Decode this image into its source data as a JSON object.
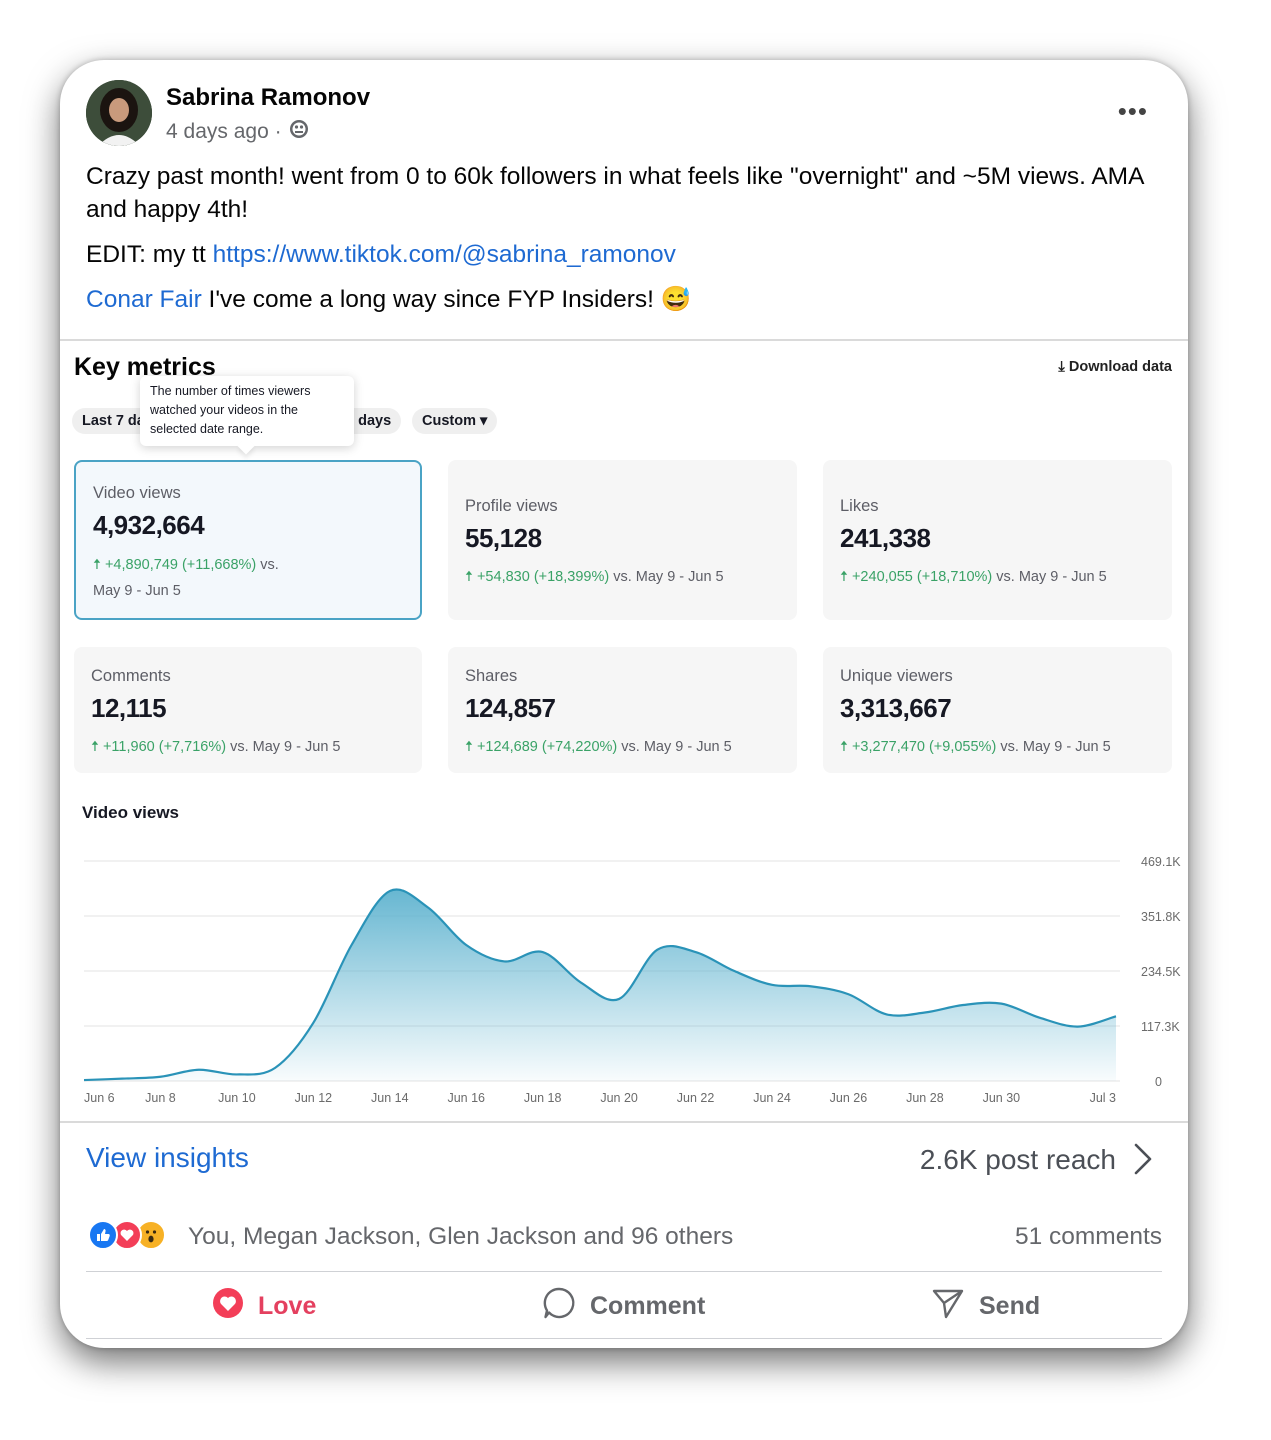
{
  "post": {
    "author": "Sabrina Ramonov",
    "time": "4 days ago ·",
    "audience_icon": "globe-icon",
    "line1": "Crazy past month! went from 0 to 60k followers in what feels like \"overnight\" and ~5M views. AMA and happy 4th!",
    "edit_prefix": "EDIT: my tt ",
    "edit_link": "https://www.tiktok.com/@sabrina_ramonov",
    "mention": "Conar Fair",
    "mention_text": " I've come a long way since FYP Insiders! 😅"
  },
  "analytics": {
    "title": "Key metrics",
    "download": "Download data",
    "chips": [
      "Last 7 da",
      "0 days",
      "Custom ▾"
    ],
    "tooltip": "The number of times viewers watched your videos in the selected date range.",
    "metrics": [
      {
        "label": "Video views",
        "value": "4,932,664",
        "delta": "+4,890,749 (+11,668%)",
        "vs": "vs.",
        "period": "May 9 - Jun 5"
      },
      {
        "label": "Profile views",
        "value": "55,128",
        "delta": "+54,830 (+18,399%)",
        "vs": "vs.",
        "period": "May 9 - Jun 5"
      },
      {
        "label": "Likes",
        "value": "241,338",
        "delta": "+240,055 (+18,710%)",
        "vs": "vs.",
        "period": "May 9 - Jun 5"
      },
      {
        "label": "Comments",
        "value": "12,115",
        "delta": "+11,960 (+7,716%)",
        "vs": "vs.",
        "period": "May 9 - Jun 5"
      },
      {
        "label": "Shares",
        "value": "124,857",
        "delta": "+124,689 (+74,220%)",
        "vs": "vs.",
        "period": "May 9 - Jun 5"
      },
      {
        "label": "Unique viewers",
        "value": "3,313,667",
        "delta": "+3,277,470 (+9,055%)",
        "vs": "vs.",
        "period": "May 9 - Jun 5"
      }
    ],
    "accent": "#4aa3c5",
    "positive_color": "#3aa267"
  },
  "chart_data": {
    "type": "area",
    "title": "Video views",
    "x": [
      "Jun 6",
      "Jun 7",
      "Jun 8",
      "Jun 9",
      "Jun 10",
      "Jun 11",
      "Jun 12",
      "Jun 13",
      "Jun 14",
      "Jun 15",
      "Jun 16",
      "Jun 17",
      "Jun 18",
      "Jun 19",
      "Jun 20",
      "Jun 21",
      "Jun 22",
      "Jun 23",
      "Jun 24",
      "Jun 25",
      "Jun 26",
      "Jun 27",
      "Jun 28",
      "Jun 29",
      "Jun 30",
      "Jul 1",
      "Jul 2",
      "Jul 3"
    ],
    "values": [
      2000,
      5000,
      9000,
      24000,
      14000,
      28000,
      124000,
      290000,
      405000,
      370000,
      290000,
      255000,
      275000,
      210000,
      175000,
      280000,
      275000,
      235000,
      205000,
      202000,
      185000,
      142000,
      146000,
      162000,
      165000,
      135000,
      116000,
      138000
    ],
    "x_tick_labels": [
      "Jun 6",
      "Jun 8",
      "Jun 10",
      "Jun 12",
      "Jun 14",
      "Jun 16",
      "Jun 18",
      "Jun 20",
      "Jun 22",
      "Jun 24",
      "Jun 26",
      "Jun 28",
      "Jun 30",
      "Jul 3"
    ],
    "y_tick_labels": [
      "469.1K",
      "351.8K",
      "234.5K",
      "117.3K",
      "0"
    ],
    "y_ticks": [
      469100,
      351800,
      234500,
      117300,
      0
    ],
    "ylim": [
      0,
      469100
    ],
    "grid": true,
    "line_color": "#2a93b8",
    "fill_color": "#5fb3cf"
  },
  "footer": {
    "insights": "View insights",
    "reach": "2.6K post reach",
    "reactions_text": "You, Megan Jackson, Glen Jackson and 96 others",
    "comments": "51 comments",
    "love": "Love",
    "comment": "Comment",
    "send": "Send",
    "love_color": "#e4405f",
    "link_color": "#1e6ad2"
  }
}
